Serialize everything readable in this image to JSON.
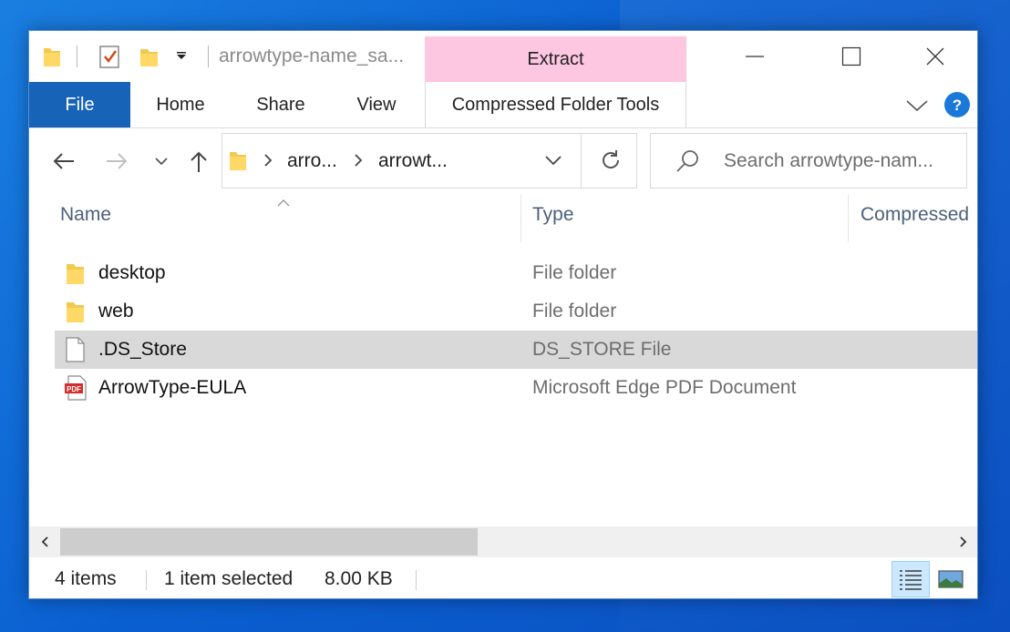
{
  "window": {
    "title": "arrowtype-name_sa...",
    "context_tab": "Extract",
    "context_group": "Compressed Folder Tools"
  },
  "ribbon": {
    "tabs": [
      "File",
      "Home",
      "Share",
      "View"
    ]
  },
  "address": {
    "segments": [
      "arro...",
      "arrowt..."
    ]
  },
  "search": {
    "placeholder": "Search arrowtype-nam..."
  },
  "columns": [
    "Name",
    "Type",
    "Compressed"
  ],
  "files": [
    {
      "name": "desktop",
      "type": "File folder",
      "icon": "folder-icon"
    },
    {
      "name": "web",
      "type": "File folder",
      "icon": "folder-icon"
    },
    {
      "name": ".DS_Store",
      "type": "DS_STORE File",
      "icon": "file-icon",
      "selected": true
    },
    {
      "name": "ArrowType-EULA",
      "type": "Microsoft Edge PDF Document",
      "icon": "pdf-icon"
    }
  ],
  "pdf_badge": "PDF",
  "status": {
    "item_count": "4 items",
    "selection": "1 item selected",
    "size": "8.00 KB"
  },
  "colors": {
    "file_tab": "#1763b8",
    "context_tab": "#fdc6e1",
    "selected_row": "#d9d9d9",
    "help": "#1a78d8"
  }
}
